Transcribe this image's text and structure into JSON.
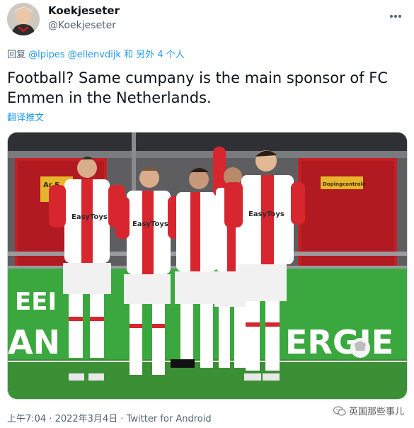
{
  "tweet": {
    "display_name": "Koekjeseter",
    "handle": "@Koekjeseter",
    "reply_prefix": "回复",
    "reply_mentions": [
      "@lpipes",
      "@ellenvdijk"
    ],
    "reply_suffix": "和 另外 4 个人",
    "text": "Football? Same cumpany is the main sponsor of FC Emmen in the Netherlands.",
    "translate_label": "翻译推文",
    "timestamp": "上午7:04 · 2022年3月4日 · Twitter for Android"
  },
  "photo": {
    "signs": [
      "Ar E",
      "Dopingcontrole"
    ],
    "sponsor": "EasyToys",
    "board_left": "EEI",
    "board_bottom": "AN",
    "board_right": "ERGIE"
  },
  "watermark": "英国那些事儿",
  "icons": {
    "more": "more-horizontal-icon",
    "watermark": "wechat-icon"
  },
  "colors": {
    "mention": "#1d9bf0",
    "kit_red": "#d8262e",
    "board_green": "#3aa83e"
  }
}
